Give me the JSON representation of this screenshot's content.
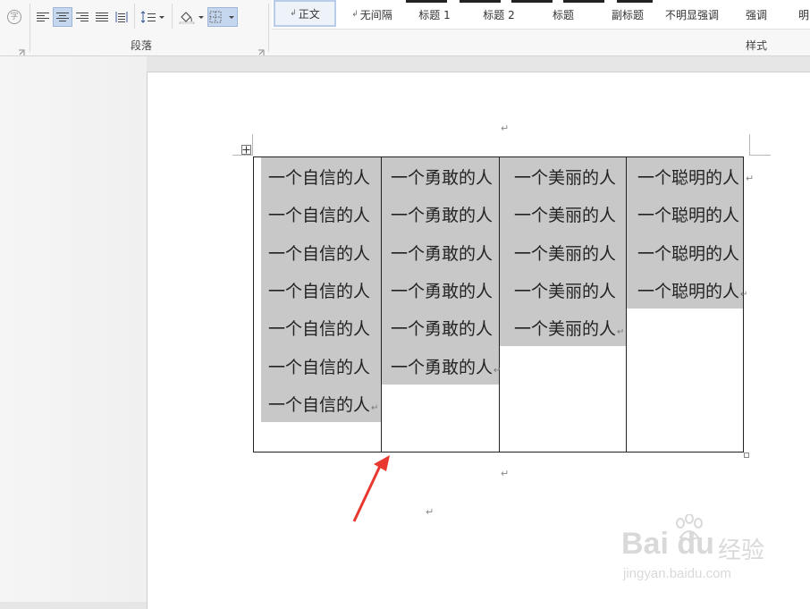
{
  "ribbon": {
    "paragraph_group_label": "段落",
    "styles_group_label": "样式",
    "char_circle_glyph": "字",
    "styles": [
      {
        "label": "正文",
        "mark": "↲",
        "selected": true
      },
      {
        "label": "无间隔",
        "mark": "↲",
        "selected": false
      },
      {
        "label": "标题 1",
        "mark": "",
        "selected": false
      },
      {
        "label": "标题 2",
        "mark": "",
        "selected": false
      },
      {
        "label": "标题",
        "mark": "",
        "selected": false
      },
      {
        "label": "副标题",
        "mark": "",
        "selected": false
      },
      {
        "label": "不明显强调",
        "mark": "",
        "selected": false
      },
      {
        "label": "强调",
        "mark": "",
        "selected": false
      },
      {
        "label": "明",
        "mark": "",
        "selected": false
      }
    ]
  },
  "document": {
    "paragraph_mark": "↵",
    "table": {
      "columns": [
        {
          "lines": [
            "一个自信的人",
            "一个自信的人",
            "一个自信的人",
            "一个自信的人",
            "一个自信的人",
            "一个自信的人",
            "一个自信的人"
          ]
        },
        {
          "lines": [
            "一个勇敢的人",
            "一个勇敢的人",
            "一个勇敢的人",
            "一个勇敢的人",
            "一个勇敢的人",
            "一个勇敢的人"
          ]
        },
        {
          "lines": [
            "一个美丽的人",
            "一个美丽的人",
            "一个美丽的人",
            "一个美丽的人",
            "一个美丽的人"
          ]
        },
        {
          "lines": [
            "一个聪明的人",
            "一个聪明的人",
            "一个聪明的人",
            "一个聪明的人"
          ]
        }
      ]
    }
  },
  "colors": {
    "shading": "#c8c8c8",
    "annotation_arrow": "#e8382f"
  },
  "watermark": {
    "brand": "Bai du",
    "jingyan": "经验",
    "url": "jingyan.baidu.com"
  }
}
